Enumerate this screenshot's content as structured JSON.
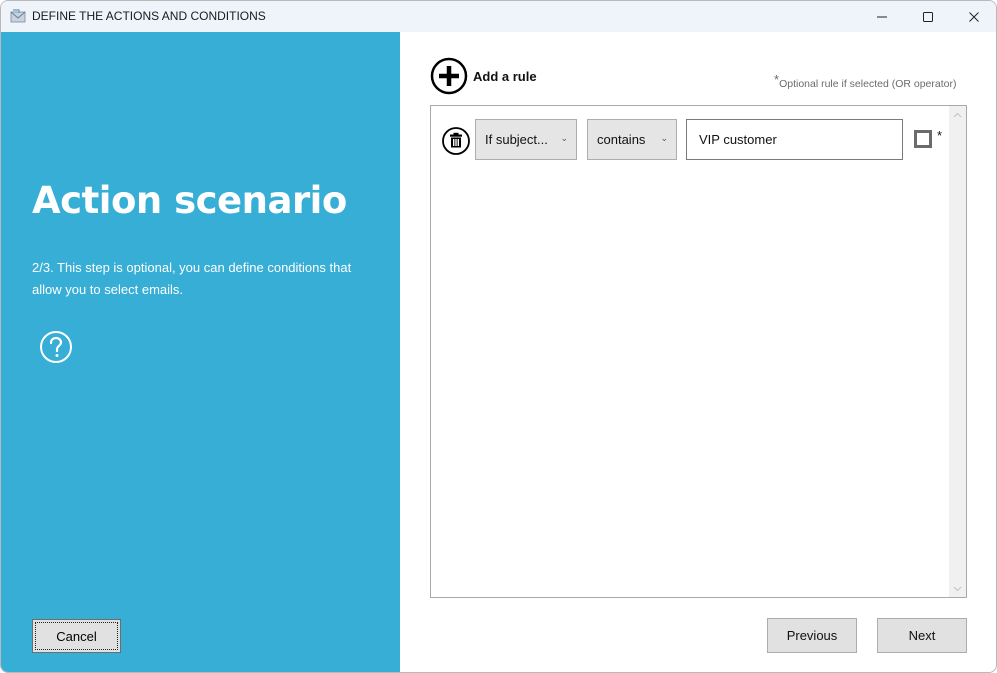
{
  "window": {
    "title": "DEFINE THE ACTIONS AND CONDITIONS",
    "app_icon": "envelope-app-icon",
    "controls": {
      "minimize": "minimize-icon",
      "maximize": "maximize-icon",
      "close": "close-icon"
    }
  },
  "left_panel": {
    "background_color": "#36aed6",
    "heading": "Action scenario",
    "description": "2/3. This step is optional, you can define conditions that allow you to select emails.",
    "help_icon": "question-circle-icon",
    "cancel_label": "Cancel"
  },
  "rules": {
    "add_rule_label": "Add a rule",
    "add_rule_icon": "plus-circle-icon",
    "optional_note_star": "*",
    "optional_note": "Optional rule if selected (OR operator)",
    "items": [
      {
        "delete_icon": "trash-icon",
        "field": "If subject...",
        "operator": "contains",
        "value": "VIP customer",
        "optional_checked": false,
        "optional_marker": "*"
      }
    ]
  },
  "footer": {
    "previous_label": "Previous",
    "next_label": "Next"
  }
}
